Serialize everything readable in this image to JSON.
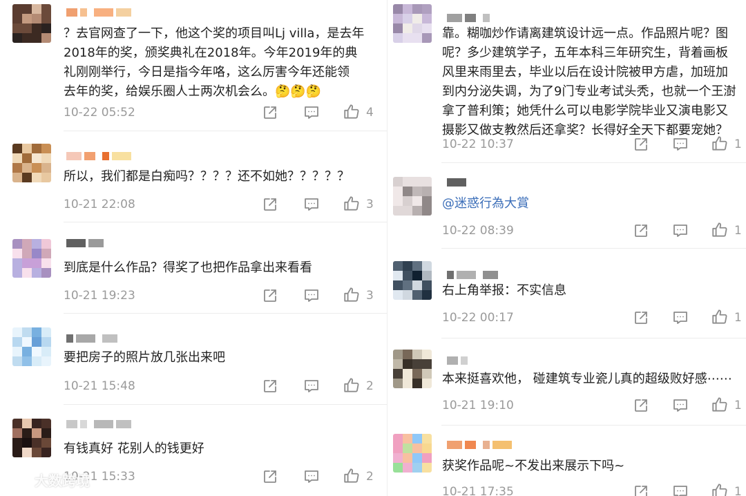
{
  "left": [
    {
      "text": "？去官网查了一下，他这个奖的项目叫Lj villa，是去年\n2018年的奖，颁奖典礼在2018年。今年2019年的典\n礼刚刚举行，今日是指今年咯，这么厉害今年还能领\n去年的奖，给娱乐圈人士两次机会么。🤔🤔🤔",
      "time": "10-22 05:52",
      "likes": "4"
    },
    {
      "text": "所以，我们都是白痴吗？？？？还不如她？？？？？",
      "time": "10-21 22:08",
      "likes": "3"
    },
    {
      "text": "到底是什么作品？得奖了也把作品拿出来看看",
      "time": "10-21 19:23",
      "likes": "3"
    },
    {
      "text": "要把房子的照片放几张出来吧",
      "time": "10-21 15:48",
      "likes": "2"
    },
    {
      "text": "有钱真好 花别人的钱更好",
      "time": "10-21 15:33",
      "likes": "2"
    }
  ],
  "right": [
    {
      "text": "靠。糊咖炒作请离建筑设计远一点。作品照片呢？图\n呢？多少建筑学子，五年本科三年研究生，背着画板\n风里来雨里去，毕业以后在设计院被甲方虐，加班加\n到内分泌失调，为了9门专业考试头秃，也就一个王澍\n拿了普利策；她凭什么可以电影学院毕业又演电影又\n摄影又做支教然后还拿奖？长得好全天下都要宠她？",
      "time": "10-22 10:37",
      "likes": "1"
    },
    {
      "text": "@迷惑行為大賞",
      "time": "10-22 08:39",
      "likes": "1",
      "mention": true
    },
    {
      "text": "右上角举报：不实信息",
      "time": "10-22 00:17",
      "likes": "1"
    },
    {
      "text": "本来挺喜欢他， 碰建筑专业瓷儿真的超级败好感⋯⋯",
      "time": "10-21 19:10",
      "likes": "1"
    },
    {
      "text": "获奖作品呢~不发出来展示下吗~",
      "time": "10-21 17:35",
      "likes": "1"
    }
  ],
  "watermark": {
    "text": "大数跨境"
  },
  "icons": {
    "share": "share-icon",
    "reply": "comment-icon",
    "like": "thumbs-up-icon",
    "watermark": "weibo-logo-icon"
  },
  "colors": {
    "text": "#222222",
    "meta": "#9a9a9a",
    "mention": "#3a6db8",
    "divider": "#ececec"
  }
}
